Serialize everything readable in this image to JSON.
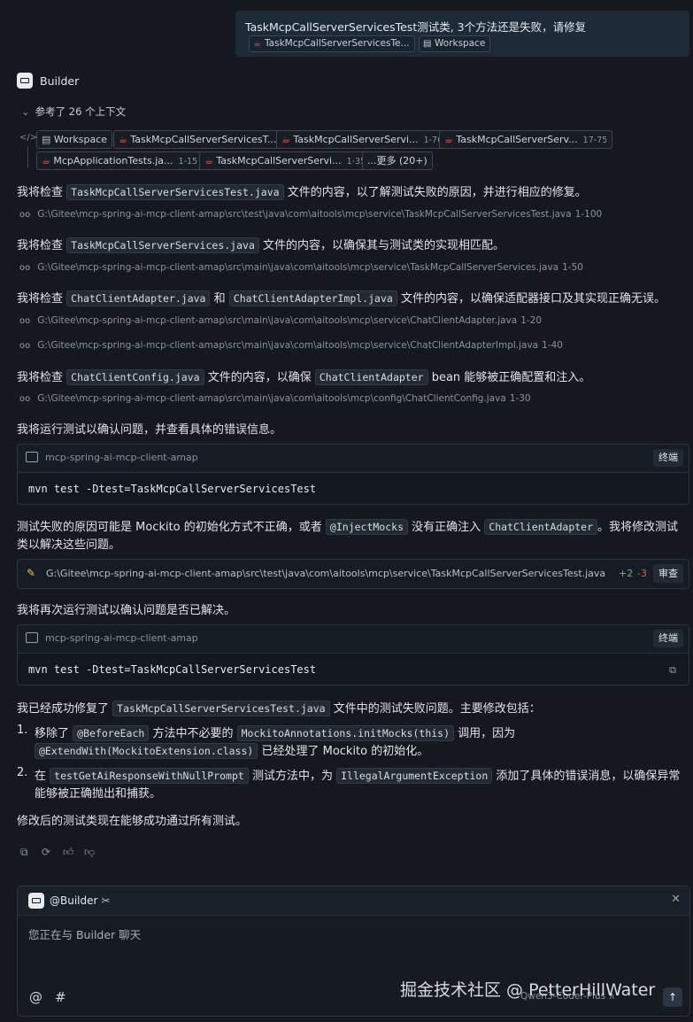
{
  "user_message": {
    "text": "TaskMcpCallServerServicesTest测试类, 3个方法还是失败，请修复",
    "chips": [
      "TaskMcpCallServerServicesTe...",
      "Workspace"
    ]
  },
  "builder": {
    "name": "Builder",
    "refs_toggle": "参考了 26 个上下文",
    "context_chips": [
      {
        "label": "Workspace",
        "range": ""
      },
      {
        "label": "TaskMcpCallServerServicesT...",
        "range": ""
      },
      {
        "label": "TaskMcpCallServerServi...",
        "range": "1-76"
      },
      {
        "label": "TaskMcpCallServerServ...",
        "range": "17-75"
      },
      {
        "label": "McpApplicationTests.ja...",
        "range": "1-15"
      },
      {
        "label": "TaskMcpCallServerServi...",
        "range": "1-35"
      },
      {
        "label": "...更多 (20+)",
        "range": ""
      }
    ]
  },
  "steps": {
    "p1_a": "我将检查",
    "p1_code": "TaskMcpCallServerServicesTest.java",
    "p1_b": "文件的内容，以了解测试失败的原因，并进行相应的修复。",
    "path1": "G:\\Gitee\\mcp-spring-ai-mcp-client-amap\\src\\test\\java\\com\\aitools\\mcp\\service\\TaskMcpCallServerServicesTest.java",
    "path1_rng": "1-100",
    "p2_a": "我将检查",
    "p2_code": "TaskMcpCallServerServices.java",
    "p2_b": "文件的内容，以确保其与测试类的实现相匹配。",
    "path2": "G:\\Gitee\\mcp-spring-ai-mcp-client-amap\\src\\main\\java\\com\\aitools\\mcp\\service\\TaskMcpCallServerServices.java",
    "path2_rng": "1-50",
    "p3_a": "我将检查",
    "p3_code1": "ChatClientAdapter.java",
    "p3_and": "和",
    "p3_code2": "ChatClientAdapterImpl.java",
    "p3_b": "文件的内容，以确保适配器接口及其实现正确无误。",
    "path3": "G:\\Gitee\\mcp-spring-ai-mcp-client-amap\\src\\main\\java\\com\\aitools\\mcp\\service\\ChatClientAdapter.java",
    "path3_rng": "1-20",
    "path4": "G:\\Gitee\\mcp-spring-ai-mcp-client-amap\\src\\main\\java\\com\\aitools\\mcp\\service\\ChatClientAdapterImpl.java",
    "path4_rng": "1-40",
    "p4_a": "我将检查",
    "p4_code1": "ChatClientConfig.java",
    "p4_mid": "文件的内容，以确保",
    "p4_code2": "ChatClientAdapter",
    "p4_b": "bean 能够被正确配置和注入。",
    "path5": "G:\\Gitee\\mcp-spring-ai-mcp-client-amap\\src\\main\\java\\com\\aitools\\mcp\\config\\ChatClientConfig.java",
    "path5_rng": "1-30",
    "p5": "我将运行测试以确认问题，并查看具体的错误信息。",
    "term1_label": "mcp-spring-ai-mcp-client-amap",
    "term1_btn": "终端",
    "term1_cmd": "mvn test -Dtest=TaskMcpCallServerServicesTest",
    "p6_a": "测试失败的原因可能是 Mockito 的初始化方式不正确，或者",
    "p6_code1": "@InjectMocks",
    "p6_mid": "没有正确注入",
    "p6_code2": "ChatClientAdapter",
    "p6_b": "。我将修改测试",
    "p6_line2": "类以解决这些问题。",
    "edit_path": "G:\\Gitee\\mcp-spring-ai-mcp-client-amap\\src\\test\\java\\com\\aitools\\mcp\\service\\TaskMcpCallServerServicesTest.java",
    "edit_add": "+2",
    "edit_del": "-3",
    "edit_btn": "审查",
    "p7": "我将再次运行测试以确认问题是否已解决。",
    "term2_label": "mcp-spring-ai-mcp-client-amap",
    "term2_btn": "终端",
    "term2_cmd": "mvn test -Dtest=TaskMcpCallServerServicesTest",
    "p8_a": "我已经成功修复了",
    "p8_code": "TaskMcpCallServerServicesTest.java",
    "p8_b": "文件中的测试失败问题。主要修改包括：",
    "li1_num": "1.",
    "li1_a": "移除了",
    "li1_code1": "@BeforeEach",
    "li1_mid": "方法中不必要的",
    "li1_code2": "MockitoAnnotations.initMocks(this)",
    "li1_b": "调用，因为",
    "li1_code3": "@ExtendWith(MockitoExtension.class)",
    "li1_c": "已经处理了 Mockito 的初始化。",
    "li2_num": "2.",
    "li2_a": "在",
    "li2_code1": "testGetAiResponseWithNullPrompt",
    "li2_mid": "测试方法中，为",
    "li2_code2": "IllegalArgumentException",
    "li2_b": "添加了具体的错误消息，以确保异常",
    "li2_c": "能够被正确抛出和捕获。",
    "p9": "修改后的测试类现在能够成功通过所有测试。"
  },
  "composer": {
    "tag": "@Builder",
    "placeholder": "您正在与 Builder 聊天",
    "at": "@",
    "hash": "#",
    "model": "Qwen3-Coder-Plus ∧"
  },
  "watermark": "掘金技术社区 @ PetterHillWater"
}
